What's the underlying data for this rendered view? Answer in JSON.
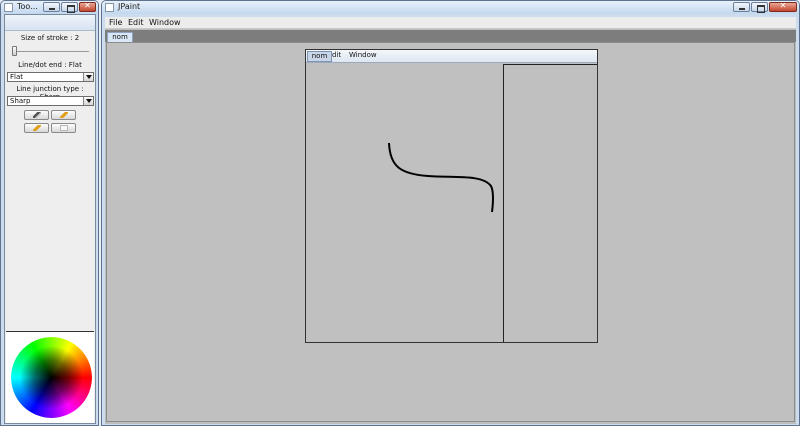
{
  "tools_window": {
    "title": "Too...",
    "stroke_label": "Size of stroke : 2",
    "stroke_size": 2,
    "line_end_label": "Line/dot end : Flat",
    "line_end_value": "Flat",
    "junction_label": "Line junction type : Sharp",
    "junction_value": "Sharp",
    "tool_icons": [
      "brush-icon",
      "pencil-icon",
      "pencil-icon",
      "eraser-icon"
    ]
  },
  "main_window": {
    "title": "JPaint",
    "menu": {
      "file": "File",
      "edit": "Edit",
      "window": "Window"
    },
    "doc_tab": "nom"
  },
  "inner_window": {
    "tab": "nom",
    "menu": {
      "edit": "dit",
      "window": "Window"
    }
  },
  "colors": {
    "title_bar": "#c2d7ee",
    "close_button": "#c4462f",
    "canvas": "#c0c0c0",
    "stroke": "#000000"
  }
}
